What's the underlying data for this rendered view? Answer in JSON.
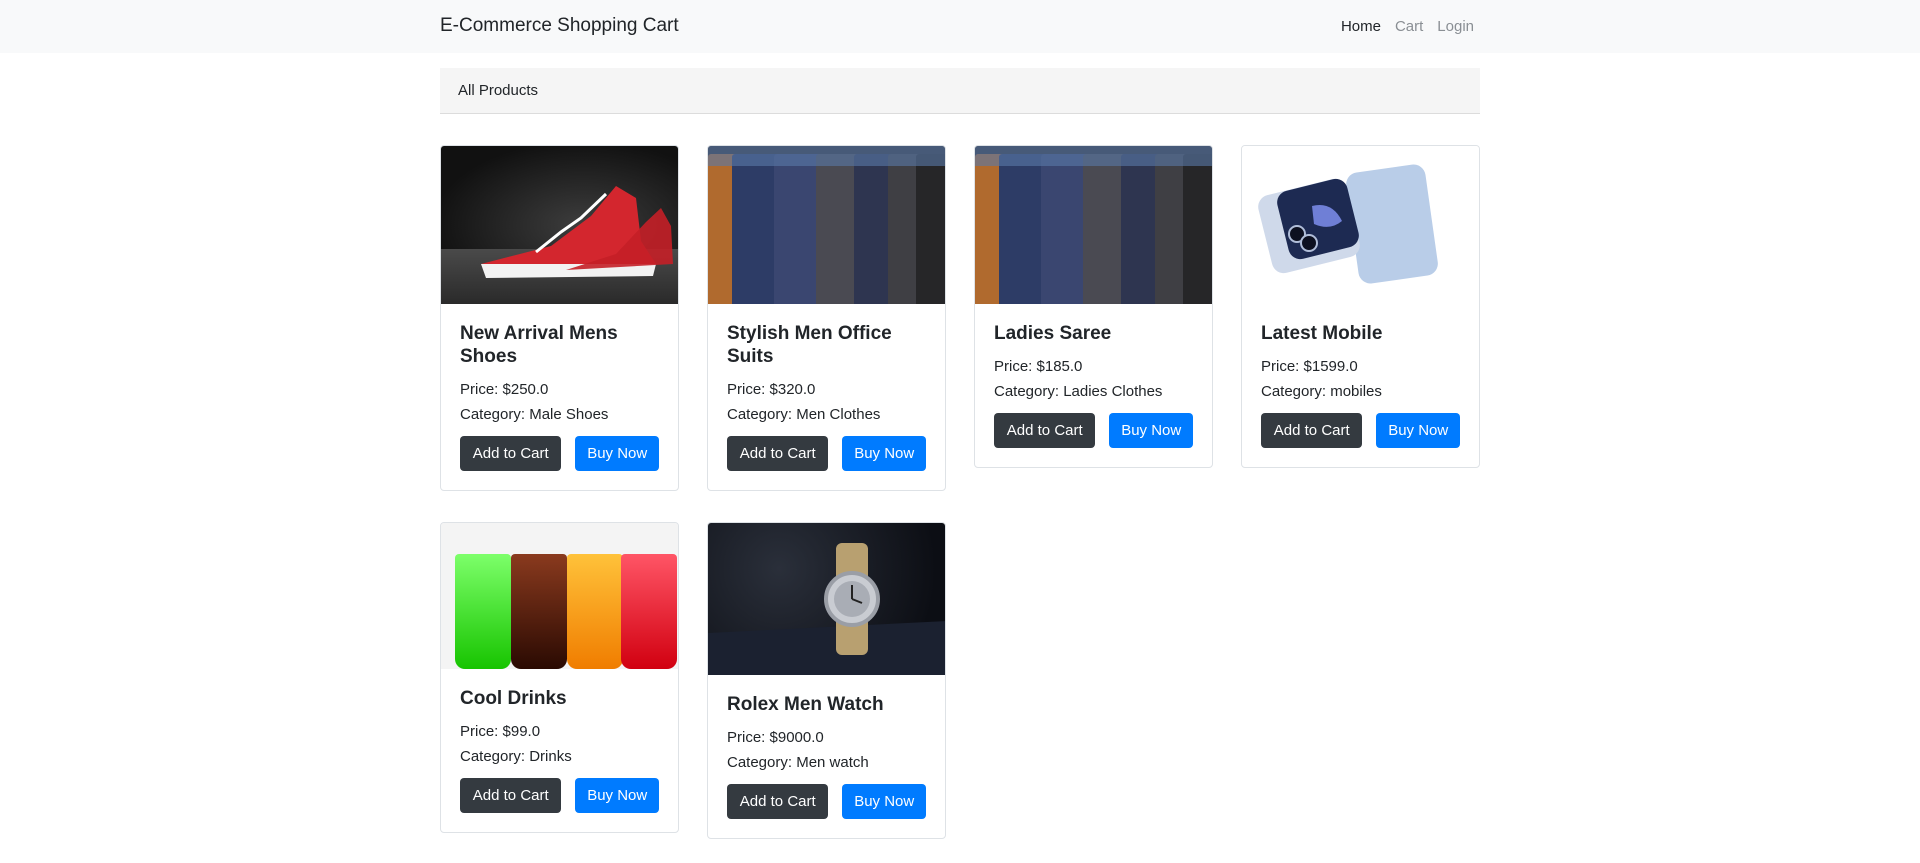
{
  "navbar": {
    "brand": "E-Commerce Shopping Cart",
    "links": [
      {
        "label": "Home",
        "active": true
      },
      {
        "label": "Cart",
        "active": false
      },
      {
        "label": "Login",
        "active": false
      }
    ]
  },
  "breadcrumb": {
    "label": "All Products"
  },
  "products": [
    {
      "title": "New Arrival Mens Shoes",
      "price": "Price: $250.0",
      "category": "Category: Male Shoes",
      "add_label": "Add to Cart",
      "buy_label": "Buy Now",
      "image_icon": "sneakers-image"
    },
    {
      "title": "Stylish Men Office Suits",
      "price": "Price: $320.0",
      "category": "Category: Men Clothes",
      "add_label": "Add to Cart",
      "buy_label": "Buy Now",
      "image_icon": "suits-image"
    },
    {
      "title": "Ladies Saree",
      "price": "Price: $185.0",
      "category": "Category: Ladies Clothes",
      "add_label": "Add to Cart",
      "buy_label": "Buy Now",
      "image_icon": "suits-image"
    },
    {
      "title": "Latest Mobile",
      "price": "Price: $1599.0",
      "category": "Category: mobiles",
      "add_label": "Add to Cart",
      "buy_label": "Buy Now",
      "image_icon": "foldable-phone-image"
    },
    {
      "title": "Cool Drinks",
      "price": "Price: $99.0",
      "category": "Category: Drinks",
      "add_label": "Add to Cart",
      "buy_label": "Buy Now",
      "image_icon": "drinks-image"
    },
    {
      "title": "Rolex Men Watch",
      "price": "Price: $9000.0",
      "category": "Category: Men watch",
      "add_label": "Add to Cart",
      "buy_label": "Buy Now",
      "image_icon": "watch-image"
    }
  ],
  "colors": {
    "primary": "#007bff",
    "dark": "#343a40",
    "navbar_bg": "#f8f9fa"
  }
}
